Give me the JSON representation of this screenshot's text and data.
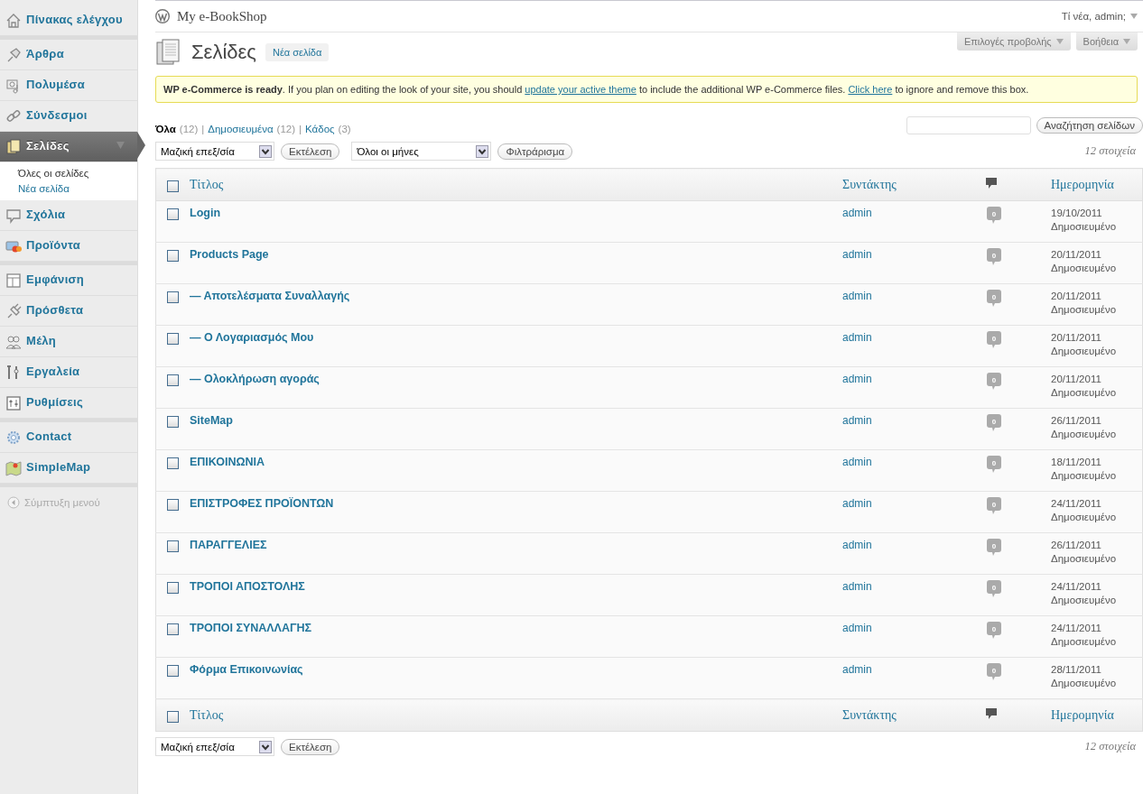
{
  "sidebar": {
    "groups": [
      [
        {
          "label": "Πίνακας ελέγχου",
          "selected": false
        }
      ],
      [
        {
          "label": "Άρθρα",
          "selected": false
        },
        {
          "label": "Πολυμέσα",
          "selected": false
        },
        {
          "label": "Σύνδεσμοι",
          "selected": false
        },
        {
          "label": "Σελίδες",
          "selected": true,
          "expanded": true,
          "children": [
            {
              "label": "Όλες οι σελίδες",
              "selected": true
            },
            {
              "label": "Νέα σελίδα",
              "selected": false
            }
          ]
        },
        {
          "label": "Σχόλια",
          "selected": false
        },
        {
          "label": "Προϊόντα",
          "selected": false
        }
      ],
      [
        {
          "label": "Εμφάνιση",
          "selected": false
        },
        {
          "label": "Πρόσθετα",
          "selected": false
        },
        {
          "label": "Μέλη",
          "selected": false
        },
        {
          "label": "Εργαλεία",
          "selected": false
        },
        {
          "label": "Ρυθμίσεις",
          "selected": false
        }
      ],
      [
        {
          "label": "Contact",
          "selected": false
        },
        {
          "label": "SimpleMap",
          "selected": false
        }
      ]
    ],
    "collapse": "Σύμπτυξη μενού"
  },
  "header": {
    "site_title": "My e-BookShop",
    "greeting": "Τί νέα, admin;"
  },
  "screen_tabs": [
    "Επιλογές προβολής",
    "Βοήθεια"
  ],
  "page": {
    "title": "Σελίδες",
    "add_new": "Νέα σελίδα"
  },
  "notice": [
    {
      "kind": "bold",
      "text": "WP e-Commerce is ready"
    },
    {
      "kind": "text",
      "text": ". If you plan on editing the look of your site, you should "
    },
    {
      "kind": "link",
      "text": "update your active theme"
    },
    {
      "kind": "text",
      "text": " to include the additional WP e-Commerce files. "
    },
    {
      "kind": "link",
      "text": "Click here"
    },
    {
      "kind": "text",
      "text": " to ignore and remove this box."
    }
  ],
  "views": [
    {
      "label": "Όλα",
      "count": "(12)",
      "selected": true
    },
    {
      "label": "Δημοσιευμένα",
      "count": "(12)",
      "selected": false
    },
    {
      "label": "Κάδος",
      "count": "(3)",
      "selected": false
    }
  ],
  "view_separator": "|",
  "search": {
    "button": "Αναζήτηση σελίδων"
  },
  "top_actions": {
    "bulk": "Μαζική επεξ/σία",
    "apply": "Εκτέλεση",
    "months": "Όλοι οι μήνες",
    "filter": "Φιλτράρισμα",
    "count": "12 στοιχεία"
  },
  "table": {
    "header": {
      "checked": false,
      "columns": [
        "Τίτλος",
        "Συντάκτης",
        "Ημερομηνία"
      ]
    },
    "footer": {
      "checked": false,
      "columns": [
        "Τίτλος",
        "Συντάκτης",
        "Ημερομηνία"
      ]
    },
    "rows": [
      {
        "title": "Login",
        "author": "admin",
        "comments": "0",
        "date": "19/10/2011",
        "status": "Δημοσιευμένο",
        "checked": false
      },
      {
        "title": "Products Page",
        "author": "admin",
        "comments": "0",
        "date": "20/11/2011",
        "status": "Δημοσιευμένο",
        "checked": false
      },
      {
        "title": "— Αποτελέσματα Συναλλαγής",
        "author": "admin",
        "comments": "0",
        "date": "20/11/2011",
        "status": "Δημοσιευμένο",
        "checked": false
      },
      {
        "title": "— Ο Λογαριασμός Μου",
        "author": "admin",
        "comments": "0",
        "date": "20/11/2011",
        "status": "Δημοσιευμένο",
        "checked": false
      },
      {
        "title": "— Ολοκλήρωση αγοράς",
        "author": "admin",
        "comments": "0",
        "date": "20/11/2011",
        "status": "Δημοσιευμένο",
        "checked": false
      },
      {
        "title": "SiteMap",
        "author": "admin",
        "comments": "0",
        "date": "26/11/2011",
        "status": "Δημοσιευμένο",
        "checked": false
      },
      {
        "title": "ΕΠΙΚΟΙΝΩΝΙΑ",
        "author": "admin",
        "comments": "0",
        "date": "18/11/2011",
        "status": "Δημοσιευμένο",
        "checked": false
      },
      {
        "title": "ΕΠΙΣΤΡΟΦΕΣ ΠΡΟΪΟΝΤΩΝ",
        "author": "admin",
        "comments": "0",
        "date": "24/11/2011",
        "status": "Δημοσιευμένο",
        "checked": false
      },
      {
        "title": "ΠΑΡΑΓΓΕΛΙΕΣ",
        "author": "admin",
        "comments": "0",
        "date": "26/11/2011",
        "status": "Δημοσιευμένο",
        "checked": false
      },
      {
        "title": "ΤΡΟΠΟΙ ΑΠΟΣΤΟΛΗΣ",
        "author": "admin",
        "comments": "0",
        "date": "24/11/2011",
        "status": "Δημοσιευμένο",
        "checked": false
      },
      {
        "title": "ΤΡΟΠΟΙ ΣΥΝΑΛΛΑΓΗΣ",
        "author": "admin",
        "comments": "0",
        "date": "24/11/2011",
        "status": "Δημοσιευμένο",
        "checked": false
      },
      {
        "title": "Φόρμα Επικοινωνίας",
        "author": "admin",
        "comments": "0",
        "date": "28/11/2011",
        "status": "Δημοσιευμένο",
        "checked": false
      }
    ]
  },
  "bottom_actions": {
    "bulk": "Μαζική επεξ/σία",
    "apply": "Εκτέλεση",
    "count": "12 στοιχεία"
  }
}
